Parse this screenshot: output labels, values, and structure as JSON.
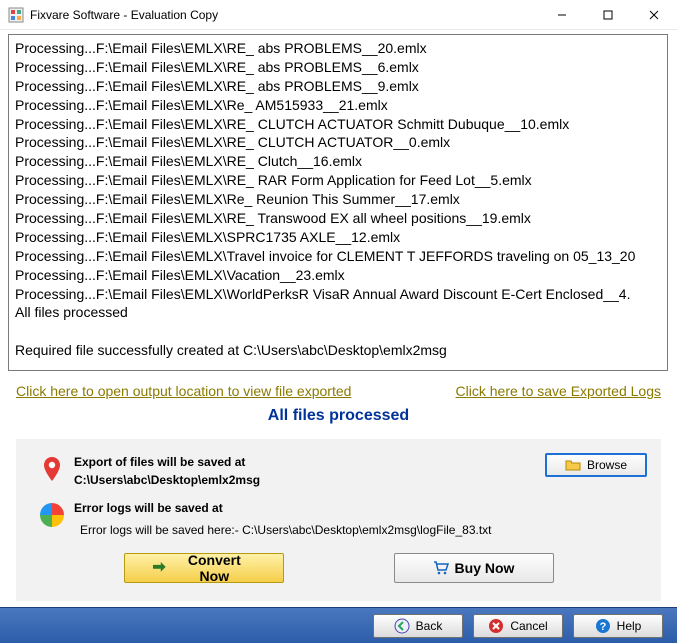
{
  "titlebar": {
    "title": "Fixvare Software - Evaluation Copy"
  },
  "log": {
    "lines": [
      "Processing...F:\\Email Files\\EMLX\\RE_ abs PROBLEMS__20.emlx",
      "Processing...F:\\Email Files\\EMLX\\RE_ abs PROBLEMS__6.emlx",
      "Processing...F:\\Email Files\\EMLX\\RE_ abs PROBLEMS__9.emlx",
      "Processing...F:\\Email Files\\EMLX\\Re_ AM515933__21.emlx",
      "Processing...F:\\Email Files\\EMLX\\RE_ CLUTCH ACTUATOR Schmitt Dubuque__10.emlx",
      "Processing...F:\\Email Files\\EMLX\\RE_ CLUTCH ACTUATOR__0.emlx",
      "Processing...F:\\Email Files\\EMLX\\RE_ Clutch__16.emlx",
      "Processing...F:\\Email Files\\EMLX\\RE_ RAR Form Application for Feed Lot__5.emlx",
      "Processing...F:\\Email Files\\EMLX\\Re_ Reunion This Summer__17.emlx",
      "Processing...F:\\Email Files\\EMLX\\RE_ Transwood EX all wheel positions__19.emlx",
      "Processing...F:\\Email Files\\EMLX\\SPRC1735 AXLE__12.emlx",
      "Processing...F:\\Email Files\\EMLX\\Travel invoice for CLEMENT T JEFFORDS traveling on 05_13_20",
      "Processing...F:\\Email Files\\EMLX\\Vacation__23.emlx",
      "Processing...F:\\Email Files\\EMLX\\WorldPerksR VisaR Annual Award Discount E-Cert Enclosed__4.",
      "All files processed",
      "",
      "Required file successfully created at C:\\Users\\abc\\Desktop\\emlx2msg"
    ]
  },
  "links": {
    "open_output": "Click here to open output location to view file exported",
    "save_logs": "Click here to save Exported Logs"
  },
  "status": "All files processed",
  "panel": {
    "export_label": "Export of files will be saved at",
    "export_path": "C:\\Users\\abc\\Desktop\\emlx2msg",
    "browse_label": "Browse",
    "error_label": "Error logs will be saved at",
    "error_path": "Error logs will be saved here:- C:\\Users\\abc\\Desktop\\emlx2msg\\logFile_83.txt"
  },
  "actions": {
    "convert": "Convert Now",
    "buy": "Buy Now"
  },
  "footer": {
    "back": "Back",
    "cancel": "Cancel",
    "help": "Help"
  }
}
